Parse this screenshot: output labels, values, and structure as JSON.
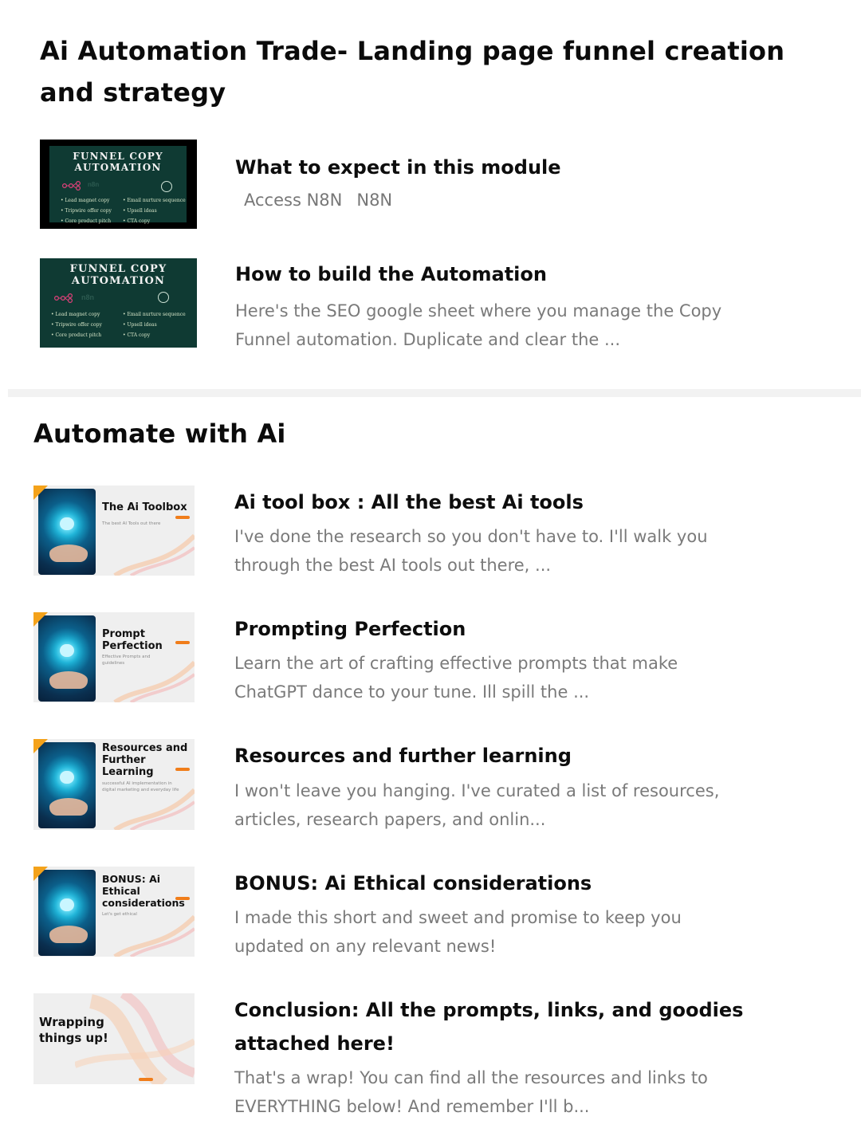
{
  "sections": [
    {
      "title": "Ai Automation Trade- Landing page funnel creation and strategy",
      "lessons": [
        {
          "title": "What to expect in this module",
          "tags": [
            "Access N8N",
            "N8N"
          ],
          "thumb": {
            "title": "FUNNEL COPY AUTOMATION",
            "brand": "n8n",
            "bullets_left": [
              "• Lead magnet copy",
              "• Tripwire offer copy",
              "• Core product pitch"
            ],
            "bullets_right": [
              "• Email nurture sequence",
              "• Upsell ideas",
              "• CTA copy"
            ]
          }
        },
        {
          "title": "How to build the Automation",
          "description": "Here's the SEO google sheet where you manage the Copy Funnel automation. Duplicate and clear the ...",
          "thumb": {
            "title": "FUNNEL COPY AUTOMATION",
            "brand": "n8n",
            "bullets_left": [
              "• Lead magnet copy",
              "• Tripwire offer copy",
              "• Core product pitch"
            ],
            "bullets_right": [
              "• Email nurture sequence",
              "• Upsell ideas",
              "• CTA copy"
            ]
          }
        }
      ]
    },
    {
      "title": "Automate with Ai",
      "lessons": [
        {
          "title": "Ai tool box : All the best Ai tools",
          "description": " I've done the research so you don't have to. I'll walk you through the best AI tools out there, ...",
          "thumb": {
            "label": "The Ai Toolbox",
            "sub": "The best AI Tools out there"
          }
        },
        {
          "title": "Prompting Perfection",
          "description": " Learn the art of crafting effective prompts that make ChatGPT dance to your tune. Ill spill the ...",
          "thumb": {
            "label": "Prompt Perfection",
            "sub": "Effective Prompts and guidelines"
          }
        },
        {
          "title": "Resources and further learning",
          "description": "I won't leave you hanging. I've curated a list of resources, articles, research papers, and onlin...",
          "thumb": {
            "label": "Resources and Further Learning",
            "sub": "successful AI implementation in digital marketing and everyday life"
          }
        },
        {
          "title": "BONUS: Ai Ethical considerations",
          "description": "I made this short and sweet and promise to keep you updated on any relevant news!",
          "thumb": {
            "label": "BONUS: Ai Ethical considerations",
            "sub": "Let's get ethical"
          }
        },
        {
          "title": "Conclusion: All the prompts, links, and goodies attached here!",
          "description": " That's a wrap! You can find all the resources and links to EVERYTHING below! And remember I'll b...",
          "thumb": {
            "label": "Wrapping things up!"
          }
        }
      ]
    }
  ],
  "colors": {
    "accent_orange": "#f07d1a",
    "funnel_green": "#0f3a33",
    "text_muted": "#7a7a7a"
  }
}
